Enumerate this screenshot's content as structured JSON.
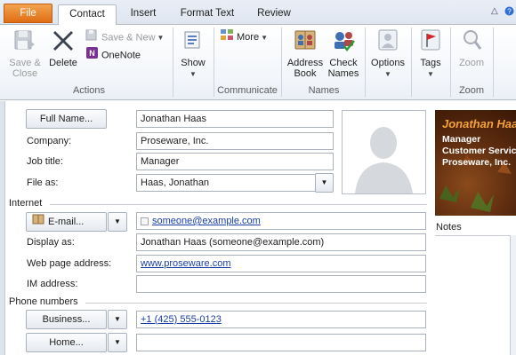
{
  "tabs": [
    {
      "label": "File"
    },
    {
      "label": "Contact"
    },
    {
      "label": "Insert"
    },
    {
      "label": "Format Text"
    },
    {
      "label": "Review"
    }
  ],
  "ribbon": {
    "actions": {
      "save_close_line1": "Save &",
      "save_close_line2": "Close",
      "delete": "Delete",
      "save_new": "Save & New",
      "onenote": "OneNote",
      "group_label": "Actions"
    },
    "show": {
      "label": "Show"
    },
    "communicate": {
      "more": "More",
      "group_label": "Communicate"
    },
    "names": {
      "address_book_line1": "Address",
      "address_book_line2": "Book",
      "check_names_line1": "Check",
      "check_names_line2": "Names",
      "group_label": "Names"
    },
    "options": {
      "label": "Options"
    },
    "tags": {
      "label": "Tags"
    },
    "zoom": {
      "label": "Zoom",
      "group_label": "Zoom"
    }
  },
  "form": {
    "full_name_button": "Full Name...",
    "full_name_value": "Jonathan Haas",
    "company_label": "Company:",
    "company_value": "Proseware, Inc.",
    "job_title_label": "Job title:",
    "job_title_value": "Manager",
    "file_as_label": "File as:",
    "file_as_value": "Haas, Jonathan",
    "internet_section": "Internet",
    "email_button": "E-mail...",
    "email_value": "someone@example.com",
    "display_as_label": "Display as:",
    "display_as_value": "Jonathan Haas (someone@example.com)",
    "web_page_label": "Web page address:",
    "web_page_value": "www.proseware.com",
    "im_label": "IM address:",
    "im_value": "",
    "phone_section": "Phone numbers",
    "business_button": "Business...",
    "business_value": "+1 (425) 555-0123",
    "home_button": "Home...",
    "home_value": ""
  },
  "card": {
    "name": "Jonathan Haas",
    "title": "Manager",
    "department": "Customer Service",
    "company": "Proseware, Inc."
  },
  "notes": {
    "label": "Notes"
  },
  "colors": {
    "file_tab": "#e06d13",
    "card_name": "#f3a23a",
    "card_bg": "#5a2a0e",
    "link": "#1a3fa8"
  }
}
